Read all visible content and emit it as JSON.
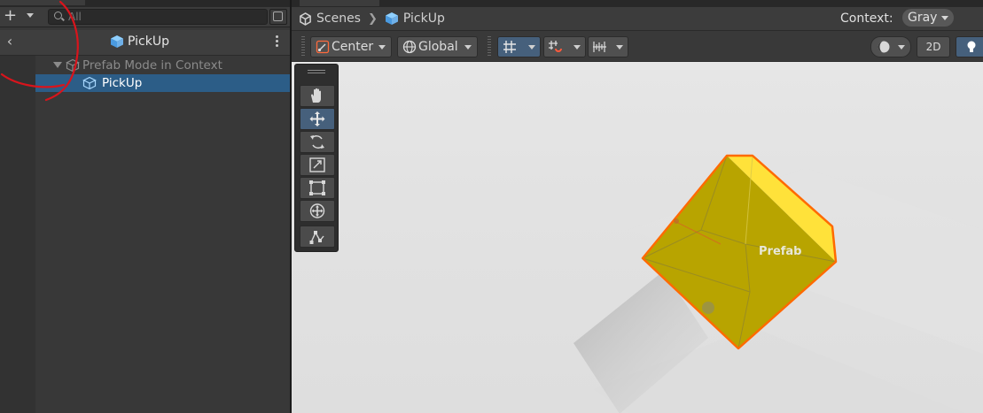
{
  "hierarchy": {
    "search": {
      "placeholder": "All"
    },
    "title": "PickUp",
    "context_row": "Prefab Mode in Context",
    "selected_row": "PickUp"
  },
  "scene": {
    "breadcrumb": {
      "root": "Scenes",
      "current": "PickUp"
    },
    "context_label": "Context:",
    "context_value": "Gray",
    "toolbar": {
      "pivot": "Center",
      "space": "Global",
      "mode_2d": "2D"
    },
    "object_label": "Prefab"
  },
  "colors": {
    "selection": "#2c5d87",
    "prefab_icon": "#6fb0e8",
    "cube": "#b8a400",
    "outline": "#ff6a00"
  }
}
